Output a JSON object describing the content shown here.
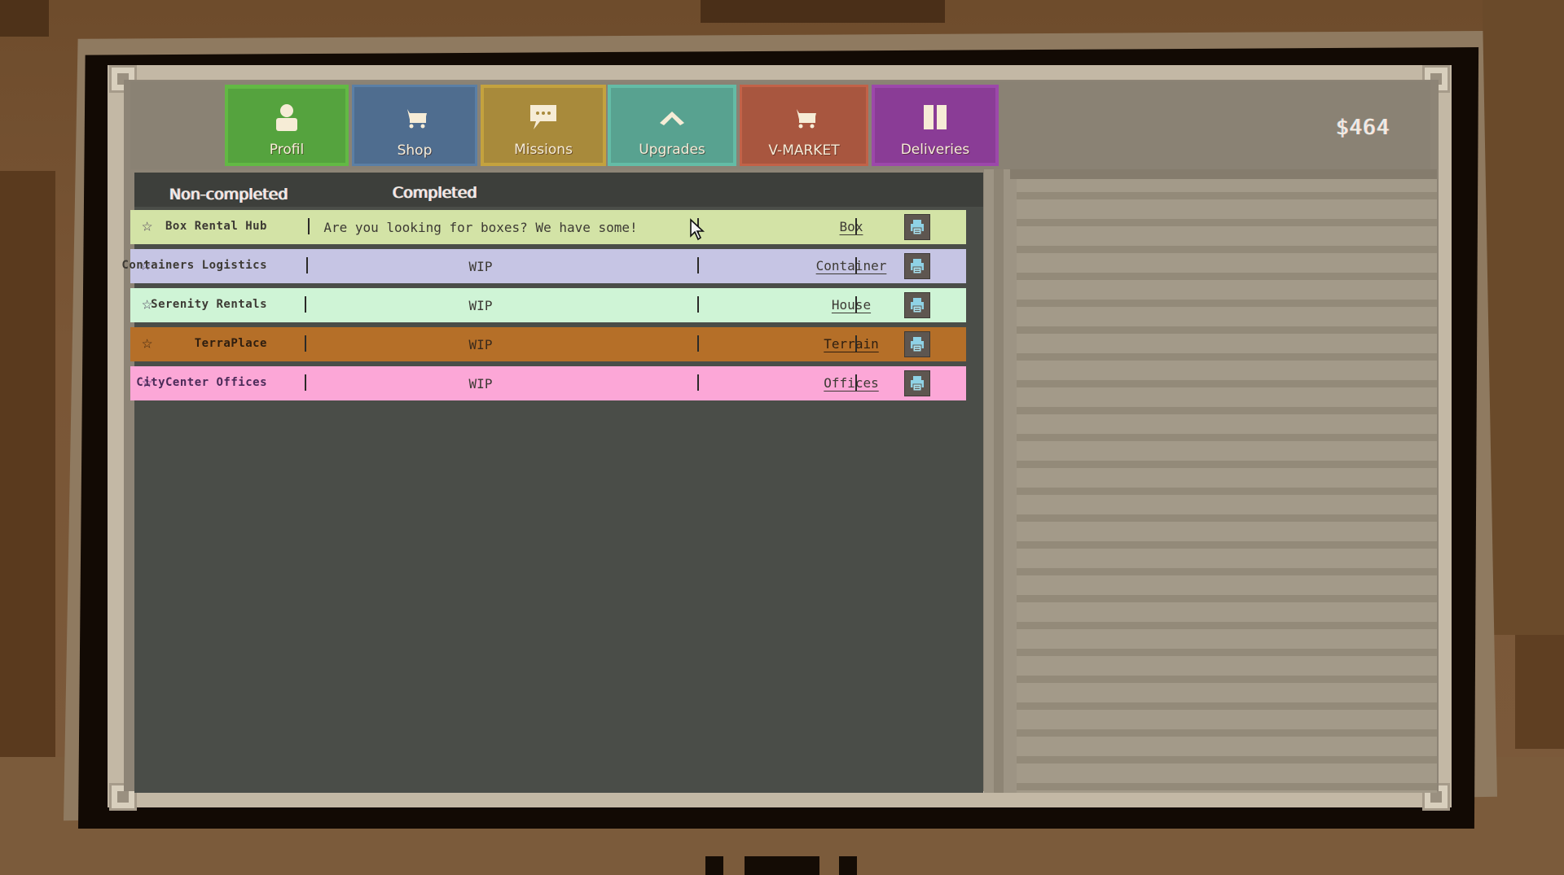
{
  "header": {
    "money": "$464"
  },
  "nav": {
    "tabs": [
      {
        "label": "Profil",
        "icon": "person-icon",
        "color": "#55a33e"
      },
      {
        "label": "Shop",
        "icon": "shopping-cart-icon",
        "color": "#4f6d8f"
      },
      {
        "label": "Missions",
        "icon": "chat-bubble-icon",
        "color": "#a88a3b"
      },
      {
        "label": "Upgrades",
        "icon": "chevron-up-icon",
        "color": "#58a290"
      },
      {
        "label": "V-MARKET",
        "icon": "shopping-cart-icon",
        "color": "#a8563f"
      },
      {
        "label": "Deliveries",
        "icon": "book-icon",
        "color": "#8a3c96"
      }
    ]
  },
  "missions": {
    "tabs": {
      "non_completed": "Non-completed",
      "completed": "Completed"
    },
    "rows": [
      {
        "name": "Box Rental Hub",
        "description": "Are you looking for boxes? We have some!",
        "category": "Box",
        "color": "#d3e3a6",
        "starred": false
      },
      {
        "name": "Containers Logistics",
        "description": "WIP",
        "category": "Container",
        "color": "#c6c5e4",
        "starred": false
      },
      {
        "name": "Serenity Rentals",
        "description": "WIP",
        "category": "House",
        "color": "#cff4d6",
        "starred": false
      },
      {
        "name": "TerraPlace",
        "description": "WIP",
        "category": "Terrain",
        "color": "#b56f28",
        "starred": false
      },
      {
        "name": "CityCenter Offices",
        "description": "WIP",
        "category": "Offices",
        "color": "#fca7d7",
        "starred": false
      }
    ]
  },
  "icons": {
    "star": "☆",
    "separator": "|"
  }
}
